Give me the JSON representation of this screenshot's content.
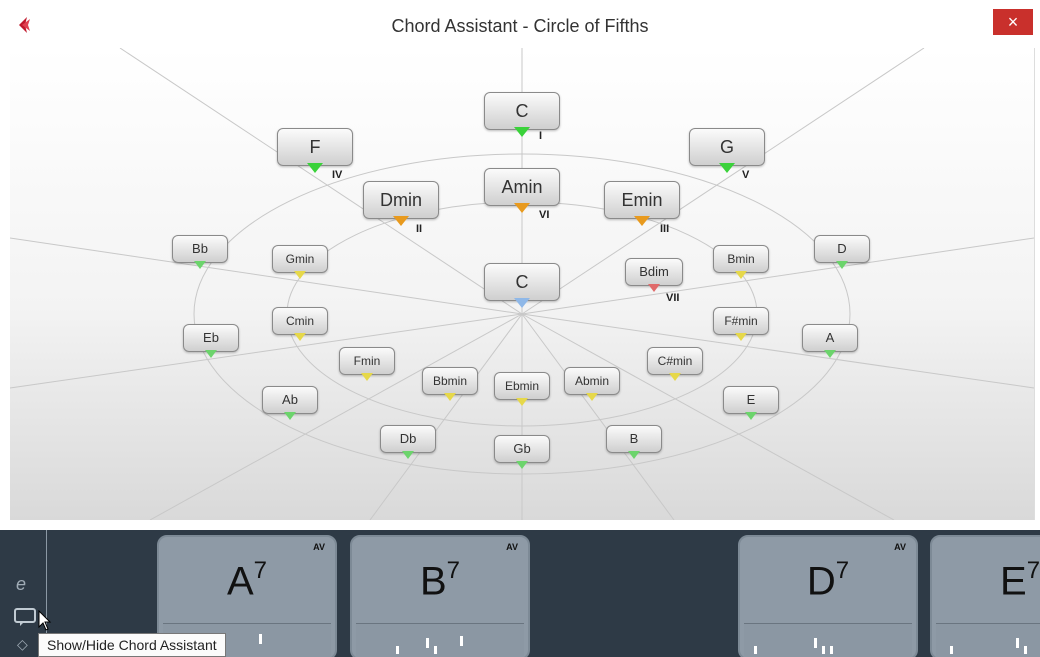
{
  "window": {
    "title": "Chord Assistant - Circle of Fifths",
    "close_glyph": "×",
    "colors": {
      "close": "#c9302c",
      "bottom_bar": "#2e3a46",
      "primary": "#3ad23a",
      "secondary": "#e89a1e",
      "dim": "#e06a6a",
      "center": "#8fb8e8",
      "outer": "#6cd46c",
      "inner": "#e6d84a"
    }
  },
  "wheel": {
    "center": {
      "label": "C",
      "marker": "blue"
    },
    "primary": [
      {
        "label": "C",
        "degree": "I"
      },
      {
        "label": "F",
        "degree": "IV"
      },
      {
        "label": "G",
        "degree": "V"
      }
    ],
    "secondary": [
      {
        "label": "Amin",
        "degree": "VI"
      },
      {
        "label": "Dmin",
        "degree": "II"
      },
      {
        "label": "Emin",
        "degree": "III"
      },
      {
        "label": "Bdim",
        "degree": "VII"
      }
    ],
    "outer": [
      "Bb",
      "Eb",
      "Ab",
      "Db",
      "Gb",
      "B",
      "E",
      "A",
      "D"
    ],
    "inner": [
      "Gmin",
      "Cmin",
      "Fmin",
      "Bbmin",
      "Ebmin",
      "Abmin",
      "C#min",
      "F#min",
      "Bmin"
    ]
  },
  "bottom": {
    "pads": [
      {
        "root": "A",
        "ext": "7",
        "av": "AV"
      },
      {
        "root": "B",
        "ext": "7",
        "av": "AV"
      },
      {
        "root": "D",
        "ext": "7",
        "av": "AV"
      },
      {
        "root": "E",
        "ext": "7",
        "av": ""
      }
    ],
    "icons": [
      "edit-mode-icon",
      "chord-assistant-icon",
      "sync-icon"
    ],
    "tooltip": "Show/Hide Chord Assistant"
  }
}
